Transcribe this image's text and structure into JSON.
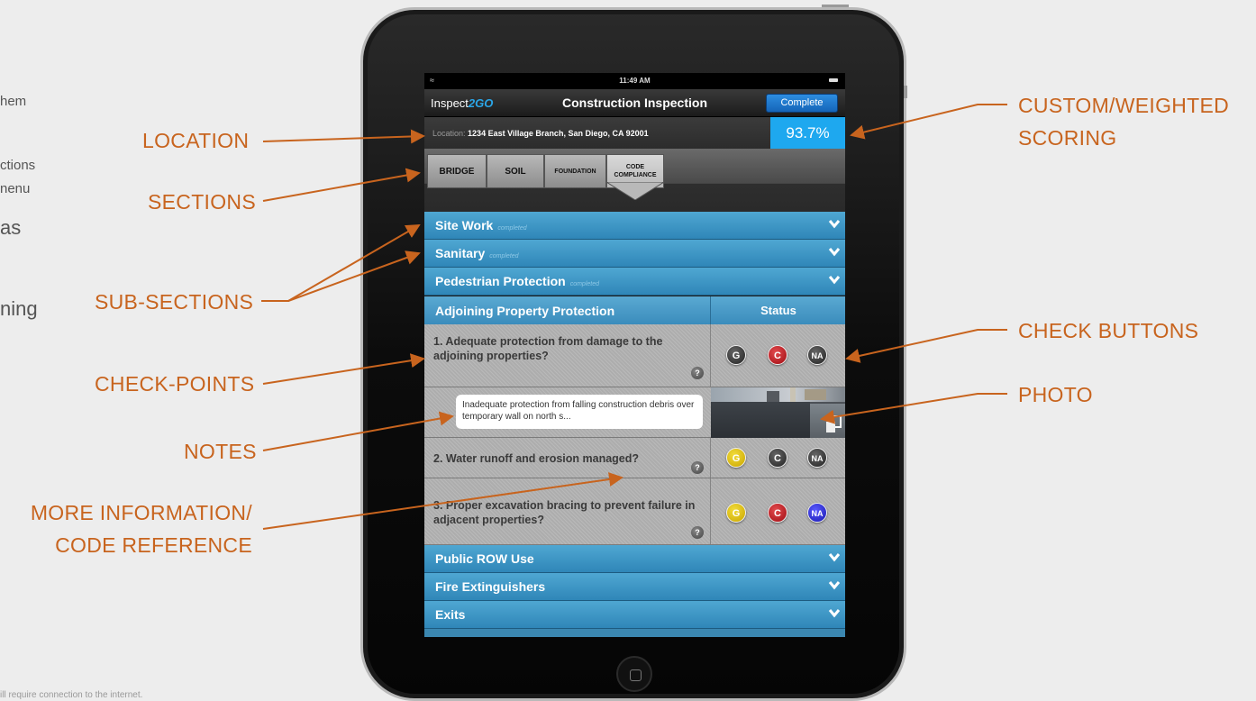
{
  "background_fragments": [
    "hem",
    "ctions",
    "nenu",
    "as",
    "ning",
    "ill require connection to the internet."
  ],
  "callouts": {
    "location": "LOCATION",
    "sections": "SECTIONS",
    "sub_sections": "SUB-SECTIONS",
    "check_points": "CHECK-POINTS",
    "notes": "NOTES",
    "more_info_1": "MORE INFORMATION/",
    "more_info_2": "CODE REFERENCE",
    "custom_1": "CUSTOM/WEIGHTED",
    "custom_2": "SCORING",
    "check_buttons": "CHECK BUTTONS",
    "photo": "PHOTO"
  },
  "app": {
    "time": "11:49 AM",
    "logo_prefix": "Inspect",
    "logo_suffix": "2GO",
    "title": "Construction Inspection",
    "complete_label": "Complete",
    "location_label": "Location:",
    "location_value": "1234 East Village Branch, San Diego, CA  92001",
    "score": "93.7%",
    "tabs": [
      "BRIDGE",
      "SOIL",
      "FOUNDATION",
      "CODE COMPLIANCE"
    ],
    "completed_tag": "completed",
    "sections_top": [
      "Site Work",
      "Sanitary",
      "Pedestrian Protection"
    ],
    "open_section": "Adjoining Property Protection",
    "status_header": "Status",
    "checkpoints": [
      "1. Adequate protection from damage to the adjoining properties?",
      "2. Water runoff and erosion managed?",
      "3. Proper excavation bracing to prevent failure in adjacent properties?"
    ],
    "note": "Inadequate protection from falling construction debris over temporary wall on north s...",
    "help_glyph": "?",
    "button_labels": {
      "g": "G",
      "c": "C",
      "na": "NA"
    },
    "sections_bottom": [
      "Public ROW Use",
      "Fire Extinguishers",
      "Exits"
    ]
  },
  "colors": {
    "callout": "#c8641e",
    "accent_blue": "#1ea8ef",
    "yellow": "#e8c000",
    "red": "#c4161c",
    "blue_na": "#2a2ad8",
    "dark_btn": "#3a3a3a"
  }
}
